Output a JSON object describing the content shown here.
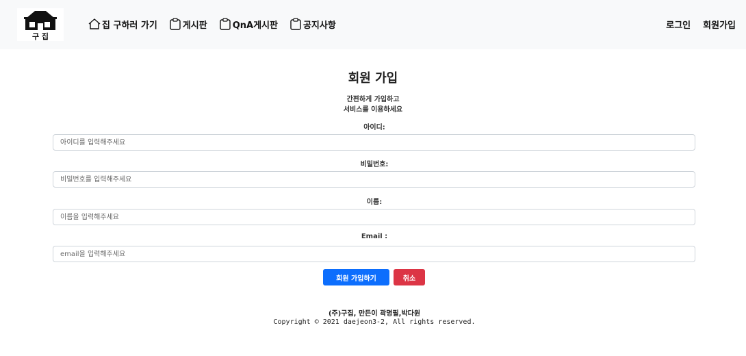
{
  "nav": {
    "logo_text": "구 집",
    "links": [
      {
        "label": "집 구하러 가기",
        "icon": "house-icon"
      },
      {
        "label": "게시판",
        "icon": "clipboard-icon"
      },
      {
        "label": "QnA게시판",
        "icon": "clipboard-icon"
      },
      {
        "label": "공지사항",
        "icon": "clipboard-icon"
      }
    ],
    "login_label": "로그인",
    "signup_label": "회원가입"
  },
  "form": {
    "title": "회원 가입",
    "subtitle_line1": "간편하게 가입하고",
    "subtitle_line2": "서비스를 이용하세요",
    "fields": [
      {
        "label": "아이디:",
        "placeholder": "아이디를 입력해주세요"
      },
      {
        "label": "비밀번호:",
        "placeholder": "비밀번호를 입력해주세요"
      },
      {
        "label": "이름:",
        "placeholder": "이름을 입력해주세요"
      },
      {
        "label": "Email :",
        "placeholder": "email을 입력해주세요"
      }
    ],
    "submit_label": "회원 가입하기",
    "cancel_label": "취소"
  },
  "footer": {
    "company": "(주)구집, 만든이 곽명필,박다원",
    "copyright": "Copyright © 2021 daejeon3-2, All rights reserved."
  },
  "colors": {
    "navbar_bg": "#f8f9fa",
    "primary": "#0d6efd",
    "danger": "#dc3545"
  }
}
